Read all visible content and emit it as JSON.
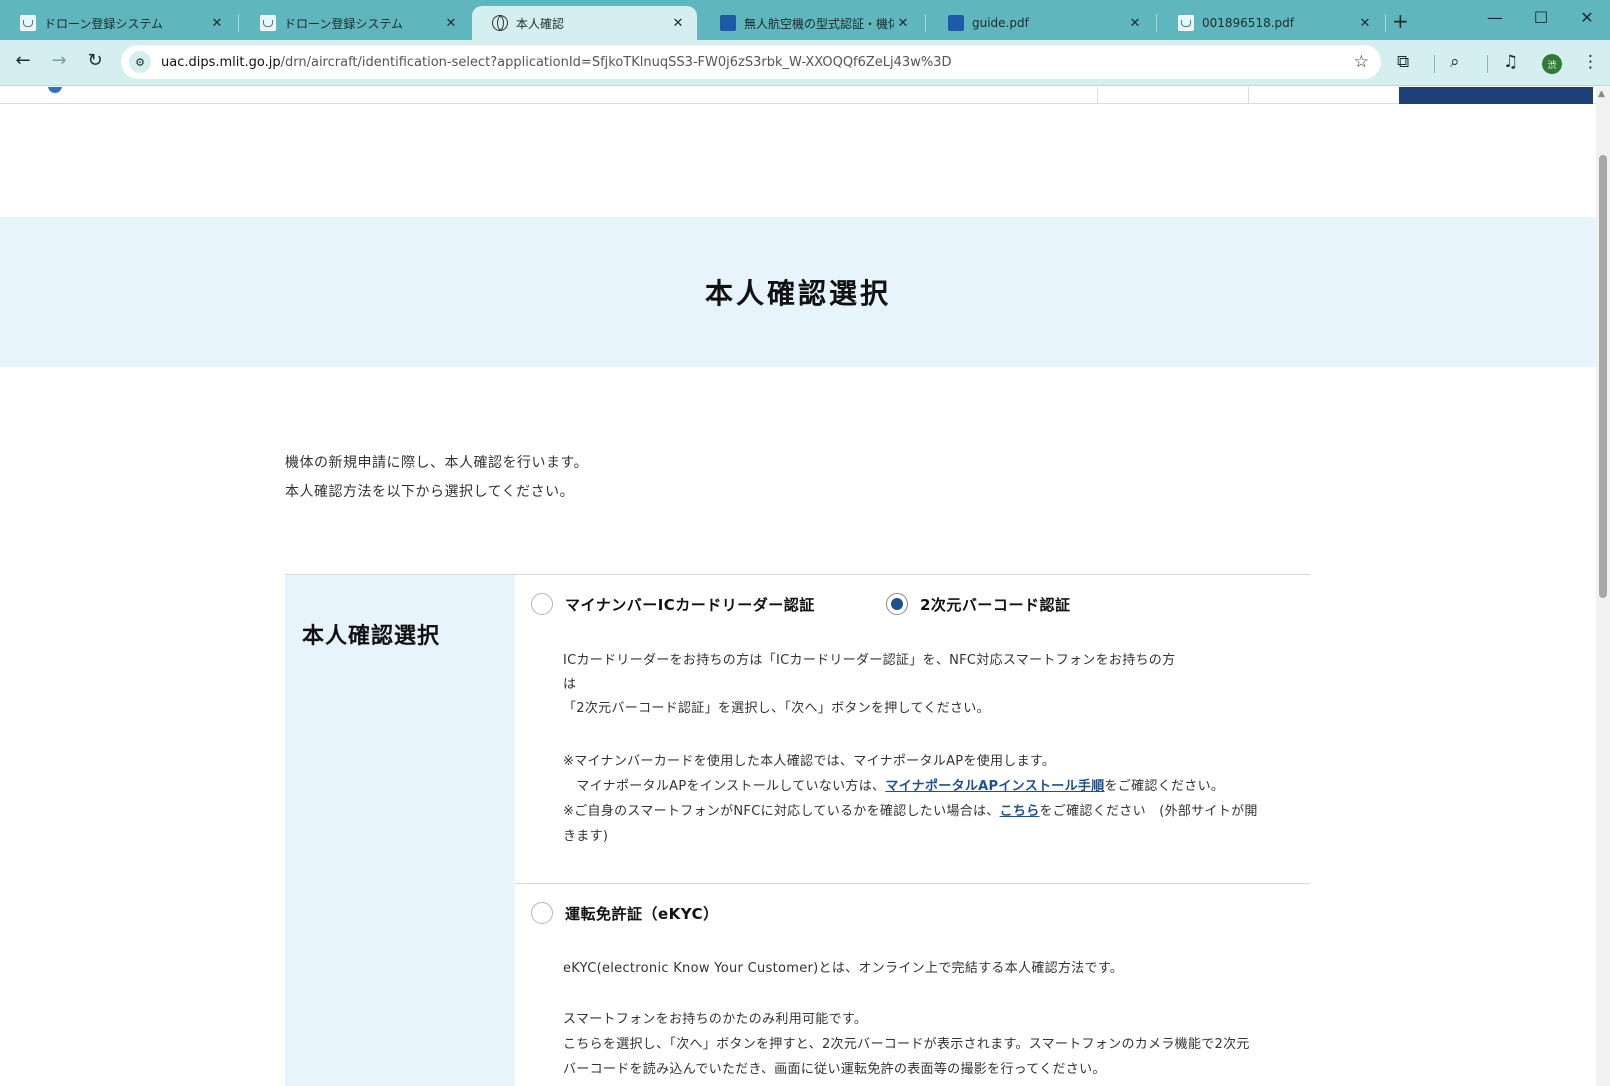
{
  "browser": {
    "tabs": [
      {
        "title": "ドローン登録システム",
        "icon": "drone-doc-icon"
      },
      {
        "title": "ドローン登録システム",
        "icon": "drone-doc-icon"
      },
      {
        "title": "本人確認",
        "icon": "globe-icon",
        "active": true
      },
      {
        "title": "無人航空機の型式認証・機体認",
        "icon": "pdf-icon",
        "icon_text": "DocuWorks"
      },
      {
        "title": "guide.pdf",
        "icon": "pdf-icon",
        "icon_text": "DocuWorks"
      },
      {
        "title": "001896518.pdf",
        "icon": "drone-doc-icon"
      }
    ],
    "close_glyph": "✕",
    "new_tab_glyph": "+",
    "url_host": "uac.dips.mlit.go.jp",
    "url_path": "/drn/aircraft/identification-select?applicationId=SfjkoTKlnuqSS3-FW0j6zS3rbk_W-XXOQQf6ZeLj43w%3D",
    "profile_initial": "渋"
  },
  "page": {
    "hero_title": "本人確認選択",
    "intro": [
      "機体の新規申請に際し、本人確認を行います。",
      "本人確認方法を以下から選択してください。"
    ],
    "section_label": "本人確認選択",
    "options": {
      "mynumber_label": "マイナンバーICカードリーダー認証",
      "barcode_label": "2次元バーコード認証",
      "barcode_selected": true,
      "ekyc_label": "運転免許証（eKYC）"
    },
    "row1_text": {
      "line1": "ICカードリーダーをお持ちの方は「ICカードリーダー認証」を、NFC対応スマートフォンをお持ちの方",
      "line2": "は",
      "line3": "「2次元バーコード認証」を選択し、「次へ」ボタンを押してください。",
      "note1": "※マイナンバーカードを使用した本人確認では、マイナポータルAPを使用します。",
      "note2_pre": "　マイナポータルAPをインストールしていない方は、",
      "note2_link": "マイナポータルAPインストール手順",
      "note2_post": "をご確認ください。",
      "note3_pre": "※ご自身のスマートフォンがNFCに対応しているかを確認したい場合は、",
      "note3_link": "こちら",
      "note3_post": "をご確認ください　(外部サイトが開",
      "note3_line2": "きます)"
    },
    "row2_text": {
      "line1": "eKYC(electronic Know Your Customer)とは、オンライン上で完結する本人確認方法です。",
      "line2": "スマートフォンをお持ちのかたのみ利用可能です。",
      "line3": "こちらを選択し、「次へ」ボタンを押すと、2次元バーコードが表示されます。スマートフォンのカメラ機能で2次元",
      "line4": "バーコードを読み込んでいただき、画面に従い運転免許の表面等の撮影を行ってください。"
    }
  }
}
